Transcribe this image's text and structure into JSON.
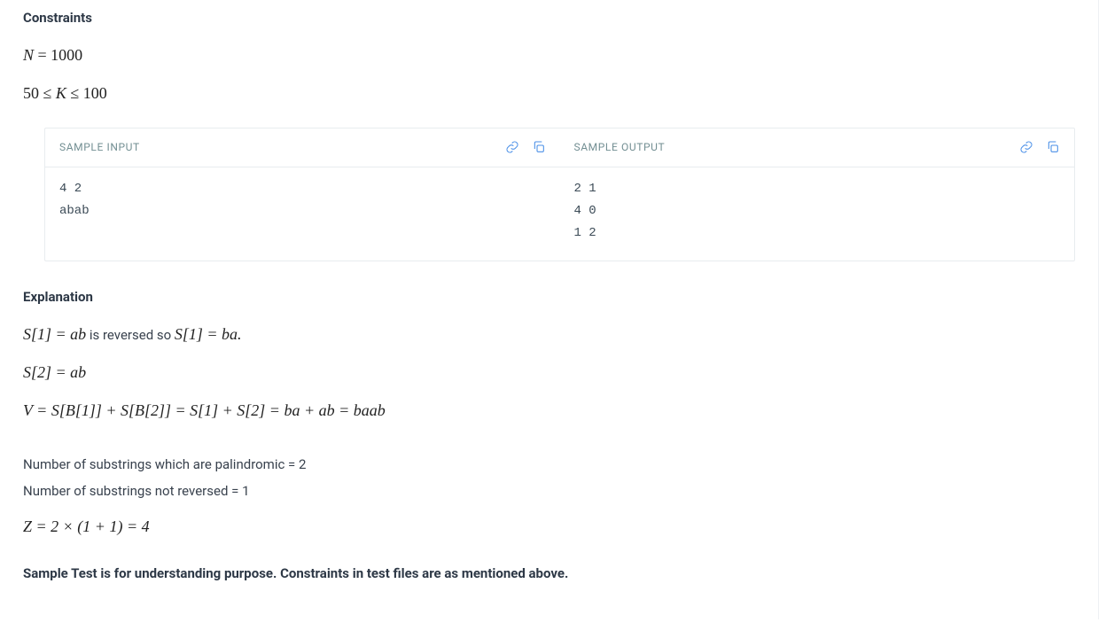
{
  "constraints": {
    "title": "Constraints",
    "line1_var": "N",
    "line1_eq": " = ",
    "line1_val": "1000",
    "line2_lhs": "50",
    "line2_op1": " ≤ ",
    "line2_var": "K",
    "line2_op2": " ≤ ",
    "line2_rhs": "100"
  },
  "sample_input": {
    "label": "SAMPLE INPUT",
    "body": "4 2\nabab"
  },
  "sample_output": {
    "label": "SAMPLE OUTPUT",
    "body": "2 1\n4 0\n1 2"
  },
  "explanation": {
    "title": "Explanation",
    "m1_a": "S[1] = ab",
    "m1_b": " is reversed so ",
    "m1_c": "S[1] = ba.",
    "m2": "S[2] = ab",
    "m3": "V = S[B[1]] + S[B[2]] = S[1] + S[2] = ba + ab = baab",
    "p1": "Number of substrings which are palindromic = 2",
    "p2": "Number of substrings not reversed = 1",
    "m4": "Z = 2 × (1 + 1) = 4",
    "note": "Sample Test is for understanding purpose. Constraints in test files are as mentioned above."
  }
}
